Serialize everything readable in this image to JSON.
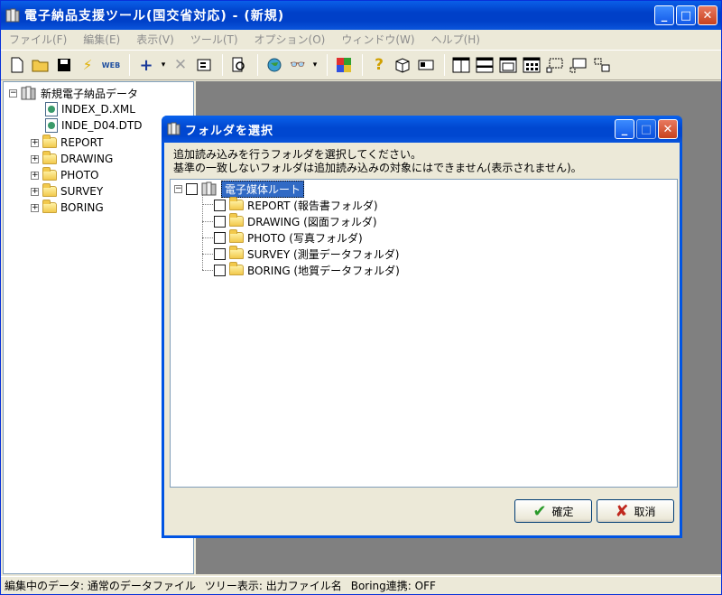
{
  "window": {
    "title": "電子納品支援ツール(国交省対応) - (新規)",
    "min": "_",
    "max": "□",
    "close": "✕"
  },
  "menu": [
    "ファイル(F)",
    "編集(E)",
    "表示(V)",
    "ツール(T)",
    "オプション(O)",
    "ウィンドウ(W)",
    "ヘルプ(H)"
  ],
  "toolbar": {
    "icons": [
      "new-file-icon",
      "open-folder-icon",
      "save-icon",
      "lightning-icon",
      "web-icon",
      "add-icon",
      "delete-icon",
      "properties-icon",
      "preview-icon",
      "globe-icon",
      "binoculars-icon",
      "palette-icon",
      "help-icon",
      "box-icon",
      "card-icon",
      "split-vertical-icon",
      "split-horizontal-icon",
      "window-icon",
      "grid-icon",
      "select-icon",
      "select2-icon",
      "select3-icon"
    ],
    "web_label": "WEB"
  },
  "tree": {
    "root": "新規電子納品データ",
    "files": [
      "INDEX_D.XML",
      "INDE_D04.DTD"
    ],
    "folders": [
      "REPORT",
      "DRAWING",
      "PHOTO",
      "SURVEY",
      "BORING"
    ]
  },
  "dialog": {
    "title": "フォルダを選択",
    "message_line1": "追加読み込みを行うフォルダを選択してください。",
    "message_line2": "基準の一致しないフォルダは追加読み込みの対象にはできません(表示されません)。",
    "root": "電子媒体ルート",
    "folders": [
      "REPORT (報告書フォルダ)",
      "DRAWING (図面フォルダ)",
      "PHOTO (写真フォルダ)",
      "SURVEY (測量データフォルダ)",
      "BORING (地質データフォルダ)"
    ],
    "ok_label": "確定",
    "cancel_label": "取消"
  },
  "status": {
    "data": "編集中のデータ: 通常のデータファイル",
    "tree": "ツリー表示: 出力ファイル名",
    "boring": "Boring連携: OFF"
  },
  "colors": {
    "titlebar": "#0040c8",
    "selection": "#316ac5",
    "mdi": "#808080"
  }
}
